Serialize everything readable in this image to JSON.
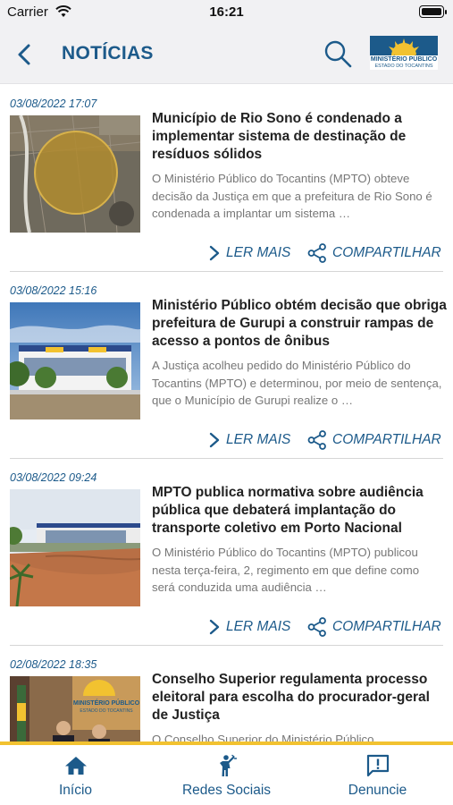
{
  "status_bar": {
    "carrier": "Carrier",
    "time": "16:21"
  },
  "header": {
    "title": "NOTÍCIAS",
    "logo_line1": "MINISTÉRIO PÚBLICO",
    "logo_line2": "ESTADO DO TOCANTINS"
  },
  "news": [
    {
      "date": "03/08/2022 17:07",
      "title": "Município de Rio Sono é condenado a implementar sistema de destinação de resíduos sólidos",
      "excerpt": "O Ministério Público do Tocantins (MPTO) obteve decisão da Justiça em que a prefeitura de Rio Sono é condenada a implantar um sistema …",
      "read_more": "LER MAIS",
      "share": "COMPARTILHAR"
    },
    {
      "date": "03/08/2022 15:16",
      "title": "Ministério Público obtém decisão que obriga prefeitura de Gurupi a construir rampas de acesso a pontos de ônibus",
      "excerpt": "A Justiça acolheu pedido do Ministério Público do Tocantins (MPTO) e determinou, por meio de sentença, que o Município de Gurupi realize o …",
      "read_more": "LER MAIS",
      "share": "COMPARTILHAR"
    },
    {
      "date": "03/08/2022 09:24",
      "title": "MPTO publica normativa sobre audiência pública que debaterá implantação do transporte coletivo em Porto Nacional",
      "excerpt": "O Ministério Público do Tocantins (MPTO) publicou nesta terça-feira, 2, regimento em que define como será conduzida uma audiência …",
      "read_more": "LER MAIS",
      "share": "COMPARTILHAR"
    },
    {
      "date": "02/08/2022 18:35",
      "title": "Conselho Superior regulamenta processo eleitoral para escolha do procurador-geral de Justiça",
      "excerpt": "O Conselho Superior do Ministério Público",
      "thumb_logo_line1": "MINISTÉRIO PÚBLICO",
      "thumb_logo_line2": "ESTADO DO TOCANTINS"
    }
  ],
  "tab_bar": {
    "home": "Início",
    "social": "Redes Sociais",
    "report": "Denuncie"
  },
  "colors": {
    "accent": "#1c5a8a",
    "highlight": "#f2c230",
    "header_bg": "#f1f1f3"
  }
}
